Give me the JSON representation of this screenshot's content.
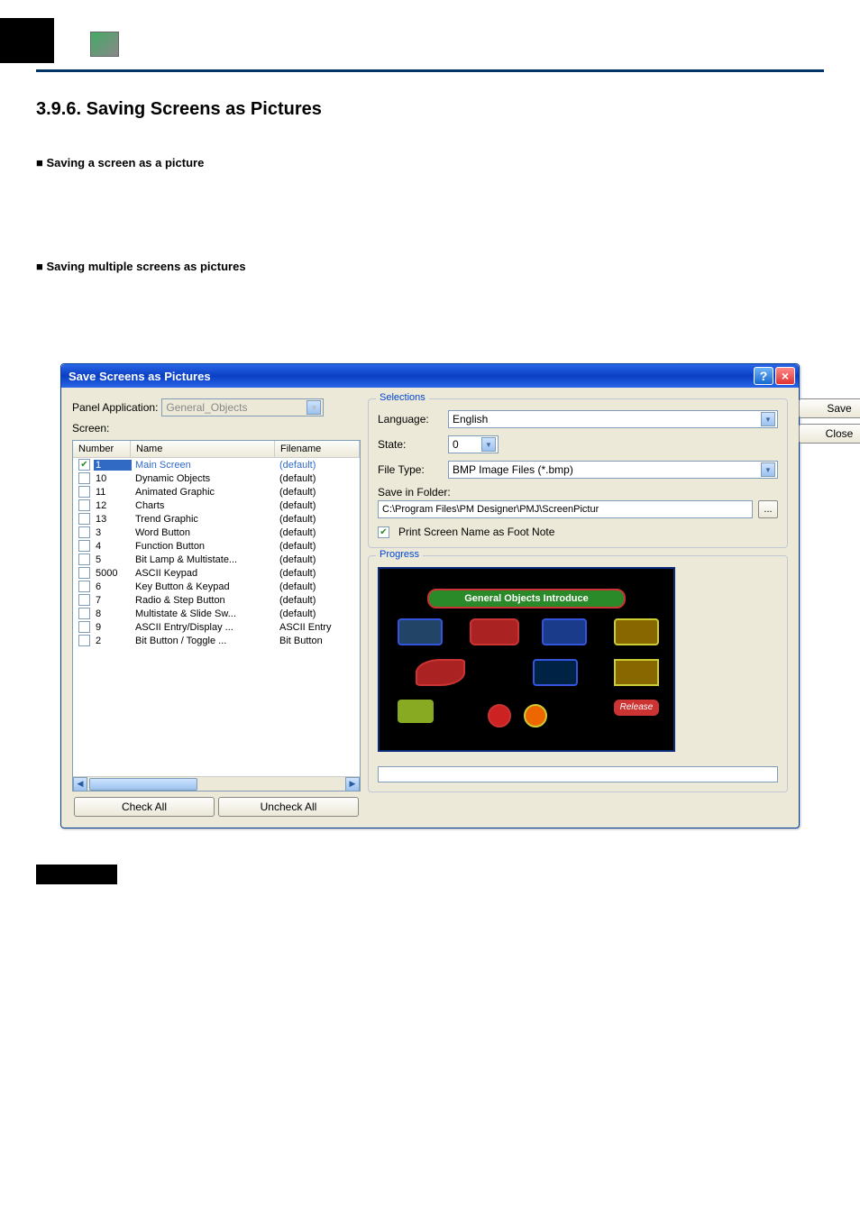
{
  "page": {
    "section_number": "3.9.6.",
    "section_title": "Saving Screens as Pictures",
    "sub1": "■ Saving a screen as a picture",
    "sub2": "■ Saving multiple screens as pictures"
  },
  "dialog": {
    "title": "Save Screens as Pictures",
    "panel_app_label": "Panel Application:",
    "panel_app_value": "General_Objects",
    "screen_label": "Screen:",
    "columns": {
      "number": "Number",
      "name": "Name",
      "filename": "Filename"
    },
    "rows": [
      {
        "checked": true,
        "selected": true,
        "num": "1",
        "name": "Main Screen",
        "file": "(default)"
      },
      {
        "checked": false,
        "selected": false,
        "num": "10",
        "name": "Dynamic Objects",
        "file": "(default)"
      },
      {
        "checked": false,
        "selected": false,
        "num": "11",
        "name": "Animated Graphic",
        "file": "(default)"
      },
      {
        "checked": false,
        "selected": false,
        "num": "12",
        "name": "Charts",
        "file": "(default)"
      },
      {
        "checked": false,
        "selected": false,
        "num": "13",
        "name": "Trend Graphic",
        "file": "(default)"
      },
      {
        "checked": false,
        "selected": false,
        "num": "3",
        "name": "Word Button",
        "file": "(default)"
      },
      {
        "checked": false,
        "selected": false,
        "num": "4",
        "name": "Function Button",
        "file": "(default)"
      },
      {
        "checked": false,
        "selected": false,
        "num": "5",
        "name": "Bit Lamp & Multistate...",
        "file": "(default)"
      },
      {
        "checked": false,
        "selected": false,
        "num": "5000",
        "name": "ASCII Keypad",
        "file": "(default)"
      },
      {
        "checked": false,
        "selected": false,
        "num": "6",
        "name": "Key Button & Keypad",
        "file": "(default)"
      },
      {
        "checked": false,
        "selected": false,
        "num": "7",
        "name": "Radio & Step Button",
        "file": "(default)"
      },
      {
        "checked": false,
        "selected": false,
        "num": "8",
        "name": "Multistate & Slide Sw...",
        "file": "(default)"
      },
      {
        "checked": false,
        "selected": false,
        "num": "9",
        "name": "ASCII Entry/Display ...",
        "file": "ASCII Entry"
      },
      {
        "checked": false,
        "selected": false,
        "num": "2",
        "name": "Bit Button / Toggle ...",
        "file": "Bit Button"
      }
    ],
    "check_all": "Check All",
    "uncheck_all": "Uncheck All",
    "selections": {
      "legend": "Selections",
      "language_label": "Language:",
      "language_value": "English",
      "state_label": "State:",
      "state_value": "0",
      "filetype_label": "File Type:",
      "filetype_value": "BMP Image Files (*.bmp)",
      "folder_label": "Save in Folder:",
      "folder_value": "C:\\Program Files\\PM Designer\\PMJ\\ScreenPictur",
      "browse": "...",
      "footnote_label": "Print Screen Name as Foot Note"
    },
    "progress": {
      "legend": "Progress",
      "banner": "General Objects Introduce"
    },
    "save": "Save",
    "close": "Close"
  }
}
